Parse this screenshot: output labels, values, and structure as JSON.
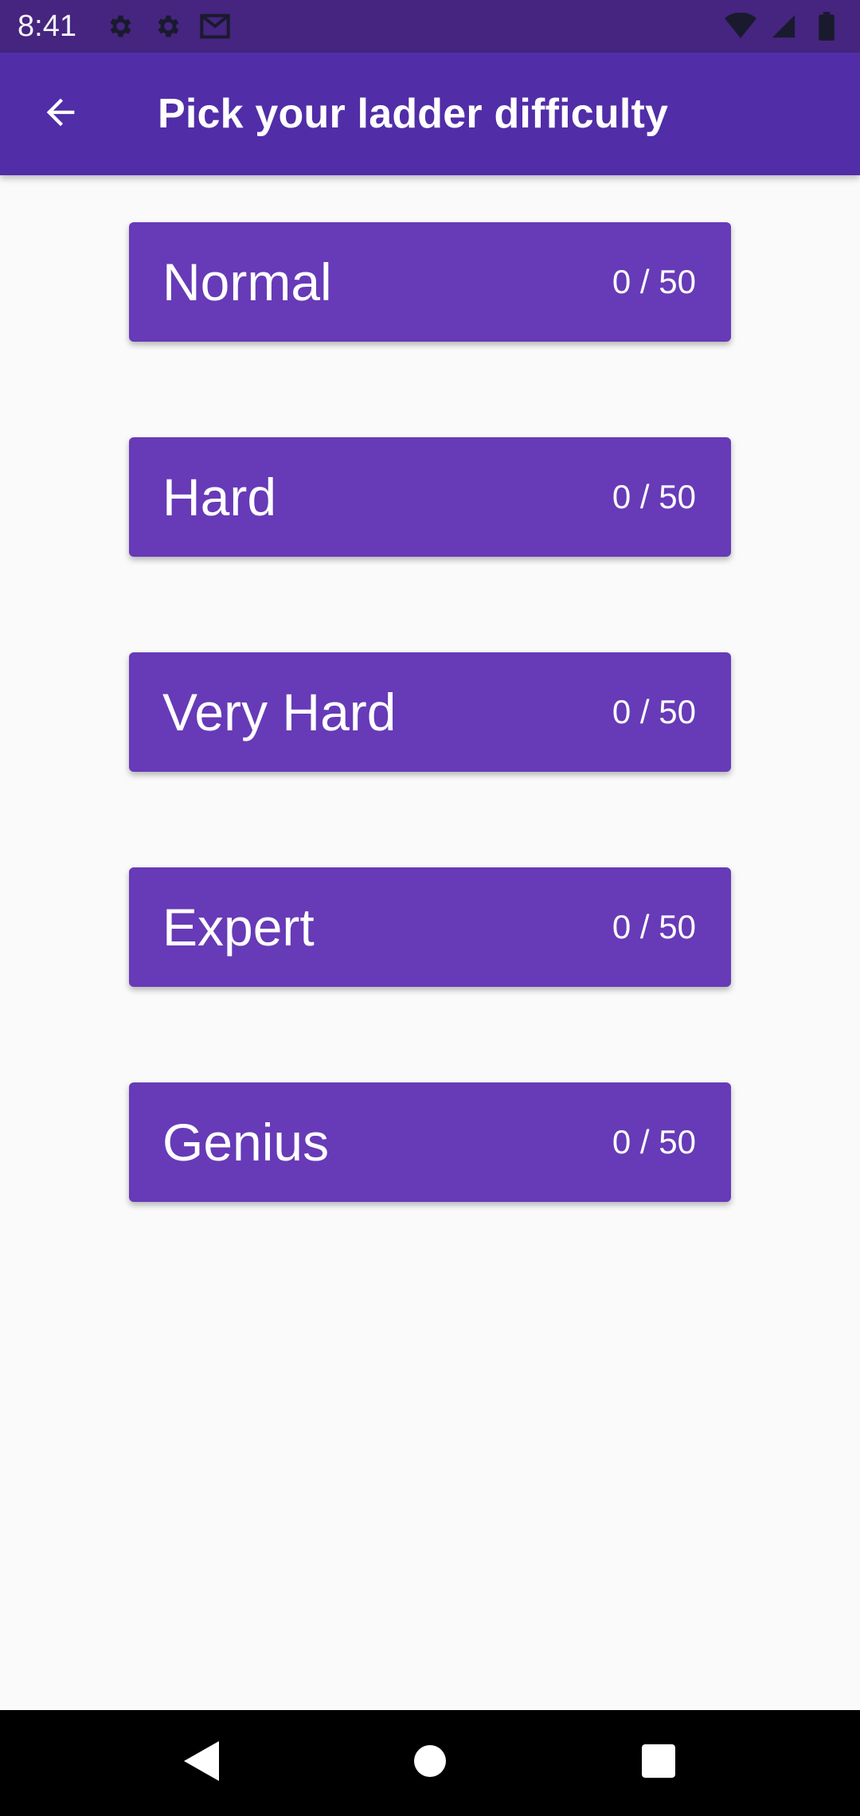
{
  "status_bar": {
    "time": "8:41",
    "icons": [
      "gear-icon",
      "gear-icon",
      "gmail-icon"
    ],
    "right_icons": [
      "wifi-icon",
      "signal-icon",
      "battery-icon"
    ]
  },
  "app_bar": {
    "title": "Pick your ladder difficulty",
    "back_icon": "arrow-back-icon"
  },
  "levels": [
    {
      "name": "Normal",
      "progress": "0 / 50"
    },
    {
      "name": "Hard",
      "progress": "0 / 50"
    },
    {
      "name": "Very Hard",
      "progress": "0 / 50"
    },
    {
      "name": "Expert",
      "progress": "0 / 50"
    },
    {
      "name": "Genius",
      "progress": "0 / 50"
    }
  ],
  "nav_bar": {
    "buttons": [
      "back-triangle-icon",
      "home-circle-icon",
      "recents-square-icon"
    ]
  },
  "colors": {
    "status_bar": "#45257f",
    "app_bar": "#512da8",
    "card": "#673ab7",
    "background": "#fafafa"
  }
}
